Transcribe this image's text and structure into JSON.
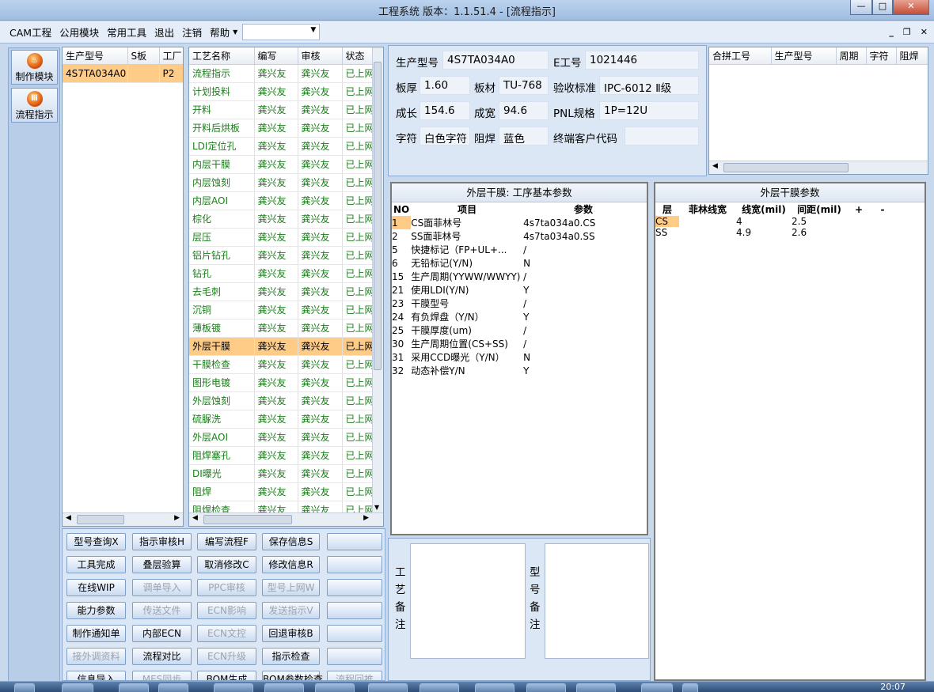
{
  "window": {
    "title": "工程系统   版本：1.1.51.4 - [流程指示]"
  },
  "menu": {
    "items": [
      "CAM工程",
      "公用模块",
      "常用工具",
      "退出",
      "注销",
      "帮助"
    ],
    "combo_value": ""
  },
  "nav": {
    "items": [
      {
        "label": "制作模块"
      },
      {
        "label": "流程指示"
      }
    ]
  },
  "model_list": {
    "columns": [
      "生产型号",
      "S板",
      "工厂"
    ],
    "rows": [
      [
        "4S7TA034A0",
        "",
        "P2"
      ]
    ]
  },
  "process_list": {
    "columns": [
      "工艺名称",
      "编写",
      "审核",
      "状态"
    ],
    "selected_index": 15,
    "rows": [
      [
        "流程指示",
        "龚兴友",
        "龚兴友",
        "已上网"
      ],
      [
        "计划投料",
        "龚兴友",
        "龚兴友",
        "已上网"
      ],
      [
        "开料",
        "龚兴友",
        "龚兴友",
        "已上网"
      ],
      [
        "开料后烘板",
        "龚兴友",
        "龚兴友",
        "已上网"
      ],
      [
        "LDI定位孔",
        "龚兴友",
        "龚兴友",
        "已上网"
      ],
      [
        "内层干膜",
        "龚兴友",
        "龚兴友",
        "已上网"
      ],
      [
        "内层蚀刻",
        "龚兴友",
        "龚兴友",
        "已上网"
      ],
      [
        "内层AOI",
        "龚兴友",
        "龚兴友",
        "已上网"
      ],
      [
        "棕化",
        "龚兴友",
        "龚兴友",
        "已上网"
      ],
      [
        "层压",
        "龚兴友",
        "龚兴友",
        "已上网"
      ],
      [
        "铝片钻孔",
        "龚兴友",
        "龚兴友",
        "已上网"
      ],
      [
        "钻孔",
        "龚兴友",
        "龚兴友",
        "已上网"
      ],
      [
        "去毛刺",
        "龚兴友",
        "龚兴友",
        "已上网"
      ],
      [
        "沉铜",
        "龚兴友",
        "龚兴友",
        "已上网"
      ],
      [
        "薄板镀",
        "龚兴友",
        "龚兴友",
        "已上网"
      ],
      [
        "外层干膜",
        "龚兴友",
        "龚兴友",
        "已上网"
      ],
      [
        "干膜检查",
        "龚兴友",
        "龚兴友",
        "已上网"
      ],
      [
        "图形电镀",
        "龚兴友",
        "龚兴友",
        "已上网"
      ],
      [
        "外层蚀刻",
        "龚兴友",
        "龚兴友",
        "已上网"
      ],
      [
        "硫脲洗",
        "龚兴友",
        "龚兴友",
        "已上网"
      ],
      [
        "外层AOI",
        "龚兴友",
        "龚兴友",
        "已上网"
      ],
      [
        "阻焊塞孔",
        "龚兴友",
        "龚兴友",
        "已上网"
      ],
      [
        "DI曝光",
        "龚兴友",
        "龚兴友",
        "已上网"
      ],
      [
        "阻焊",
        "龚兴友",
        "龚兴友",
        "已上网"
      ],
      [
        "阻焊检查",
        "龚兴友",
        "龚兴友",
        "已上网"
      ]
    ]
  },
  "info": {
    "fields": [
      {
        "label": "生产型号",
        "value": "4S7TA034A0"
      },
      {
        "label": "E工号",
        "value": "1021446"
      },
      {
        "label": "板厚",
        "value": "1.60"
      },
      {
        "label": "板材",
        "value": "TU-768"
      },
      {
        "label": "验收标准",
        "value": "IPC-6012 Ⅱ级"
      },
      {
        "label": "成长",
        "value": "154.6"
      },
      {
        "label": "成宽",
        "value": "94.6"
      },
      {
        "label": "PNL规格",
        "value": "1P=12U"
      },
      {
        "label": "字符",
        "value": "白色字符"
      },
      {
        "label": "阻焊",
        "value": "蓝色"
      },
      {
        "label": "终端客户代码",
        "value": ""
      }
    ]
  },
  "combine": {
    "columns": [
      "合拼工号",
      "生产型号",
      "周期",
      "字符",
      "阻焊"
    ]
  },
  "params": {
    "caption": "外层干膜: 工序基本参数",
    "columns": [
      "NO",
      "项目",
      "参数"
    ],
    "selected_index": 0,
    "rows": [
      [
        "1",
        "CS面菲林号",
        "4s7ta034a0.CS"
      ],
      [
        "2",
        "SS面菲林号",
        "4s7ta034a0.SS"
      ],
      [
        "5",
        "快捷标记（FP+UL+...",
        "/"
      ],
      [
        "6",
        "无铅标记(Y/N)",
        "N"
      ],
      [
        "15",
        "生产周期(YYWW/WWYY)",
        "/"
      ],
      [
        "21",
        "使用LDI(Y/N)",
        "Y"
      ],
      [
        "23",
        "干膜型号",
        "/"
      ],
      [
        "24",
        "有负焊盘（Y/N）",
        "Y"
      ],
      [
        "25",
        "干膜厚度(um)",
        "/"
      ],
      [
        "30",
        "生产周期位置(CS+SS)",
        "/"
      ],
      [
        "31",
        "采用CCD曝光（Y/N）",
        "N"
      ],
      [
        "32",
        "动态补偿Y/N",
        "Y"
      ]
    ]
  },
  "film": {
    "caption": "外层干膜参数",
    "columns": [
      "层",
      "菲林线宽",
      "线宽(mil)",
      "间距(mil)",
      "+",
      "-"
    ],
    "selected_index": 0,
    "rows": [
      [
        "CS",
        "",
        "4",
        "2.5",
        "",
        ""
      ],
      [
        "SS",
        "",
        "4.9",
        "2.6",
        "",
        ""
      ]
    ]
  },
  "remarks": {
    "process_label": "工艺备注",
    "model_label": "型号备注"
  },
  "buttons": [
    [
      {
        "label": "型号查询X",
        "enabled": true
      },
      {
        "label": "指示审核H",
        "enabled": true
      },
      {
        "label": "编写流程F",
        "enabled": true
      },
      {
        "label": "保存信息S",
        "enabled": true
      },
      {
        "label": "",
        "enabled": true
      }
    ],
    [
      {
        "label": "工具完成",
        "enabled": true
      },
      {
        "label": "叠层验算",
        "enabled": true
      },
      {
        "label": "取消修改C",
        "enabled": true
      },
      {
        "label": "修改信息R",
        "enabled": true
      },
      {
        "label": "",
        "enabled": true
      }
    ],
    [
      {
        "label": "在线WIP",
        "enabled": true
      },
      {
        "label": "调单导入",
        "enabled": false
      },
      {
        "label": "PPC审核",
        "enabled": false
      },
      {
        "label": "型号上网W",
        "enabled": false
      },
      {
        "label": "",
        "enabled": true
      }
    ],
    [
      {
        "label": "能力参数",
        "enabled": true
      },
      {
        "label": "传送文件",
        "enabled": false
      },
      {
        "label": "ECN影响",
        "enabled": false
      },
      {
        "label": "发送指示V",
        "enabled": false
      },
      {
        "label": "",
        "enabled": true
      }
    ],
    [
      {
        "label": "制作通知单",
        "enabled": true
      },
      {
        "label": "内部ECN",
        "enabled": true
      },
      {
        "label": "ECN文控",
        "enabled": false
      },
      {
        "label": "回退审核B",
        "enabled": true
      },
      {
        "label": "",
        "enabled": true
      }
    ],
    [
      {
        "label": "接外调资料",
        "enabled": false
      },
      {
        "label": "流程对比",
        "enabled": true
      },
      {
        "label": "ECN升级",
        "enabled": false
      },
      {
        "label": "指示检查",
        "enabled": true
      },
      {
        "label": "",
        "enabled": true
      }
    ],
    [
      {
        "label": "信息导入",
        "enabled": true
      },
      {
        "label": "MES同步",
        "enabled": false
      },
      {
        "label": "BOM生成",
        "enabled": true
      },
      {
        "label": "BOM参数检查",
        "enabled": true
      },
      {
        "label": "流程回推",
        "enabled": false
      }
    ]
  ],
  "taskbar": {
    "clock": "20:07"
  }
}
